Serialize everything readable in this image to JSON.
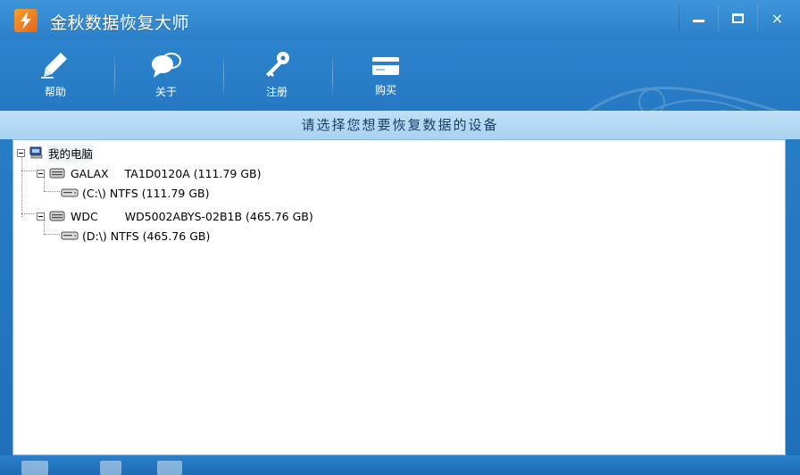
{
  "app": {
    "title": "金秋数据恢复大师"
  },
  "window_controls": {
    "minimize": "minimize",
    "maximize": "maximize",
    "close": "×"
  },
  "toolbar": {
    "items": [
      {
        "label": "帮助",
        "icon": "help-pen-icon"
      },
      {
        "label": "关于",
        "icon": "about-chat-icon"
      },
      {
        "label": "注册",
        "icon": "register-key-icon"
      },
      {
        "label": "购买",
        "icon": "buy-card-icon"
      }
    ]
  },
  "prompt": {
    "text": "请选择您想要恢复数据的设备"
  },
  "tree": {
    "root": "我的电脑",
    "disks": [
      {
        "vendor": "GALAX",
        "model": "TA1D0120A (111.79 GB)",
        "partitions": [
          "(C:\\) NTFS (111.79 GB)"
        ]
      },
      {
        "vendor": "WDC",
        "model": "WD5002ABYS-02B1B (465.76 GB)",
        "partitions": [
          "(D:\\) NTFS (465.76 GB)"
        ]
      }
    ]
  },
  "colors": {
    "titlebar": "#2b80c9",
    "prompt_bg": "#a7d3f1",
    "prompt_text": "#1c3c64",
    "logo": "#e8621b"
  }
}
